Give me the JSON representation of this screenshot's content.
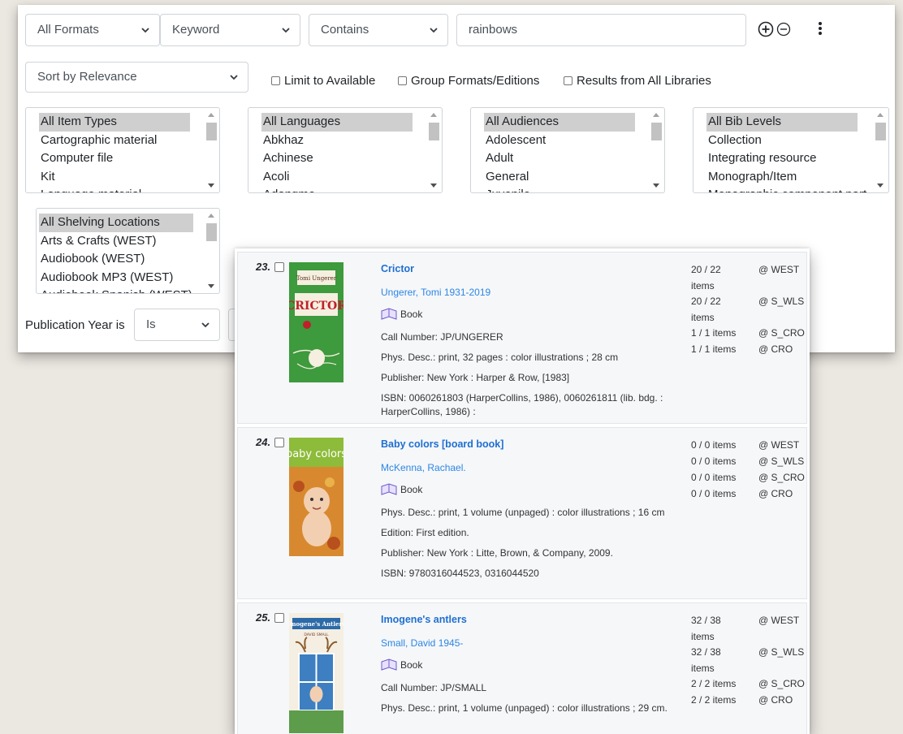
{
  "search": {
    "format": "All Formats",
    "field": "Keyword",
    "operator": "Contains",
    "query": "rainbows",
    "sort": "Sort by Relevance",
    "limit_available": "Limit to Available",
    "group_formats": "Group Formats/Editions",
    "all_libraries": "Results from All Libraries"
  },
  "filters": {
    "item_types": [
      "All Item Types",
      "Cartographic material",
      "Computer file",
      "Kit",
      "Language material"
    ],
    "languages": [
      "All Languages",
      "Abkhaz",
      "Achinese",
      "Acoli",
      "Adangme"
    ],
    "audiences": [
      "All Audiences",
      "Adolescent",
      "Adult",
      "General",
      "Juvenile"
    ],
    "bib_levels": [
      "All Bib Levels",
      "Collection",
      "Integrating resource",
      "Monograph/Item",
      "Monographic component part"
    ],
    "shelving_locations": [
      "All Shelving Locations",
      "Arts & Crafts (WEST)",
      "Audiobook (WEST)",
      "Audiobook MP3 (WEST)",
      "Audiobook Spanish (WEST)"
    ]
  },
  "publication": {
    "label": "Publication Year is",
    "operator": "Is"
  },
  "results": [
    {
      "number": "23.",
      "title": "Crictor",
      "author": "Ungerer, Tomi 1931-2019",
      "format": "Book",
      "cover_text": "CRICTOR",
      "cover_author": "Tomi Ungerer",
      "details": [
        "Call Number: JP/UNGERER",
        "Phys. Desc.: print, 32 pages : color illustrations ; 28 cm",
        "Publisher: New York : Harper & Row, [1983]",
        "ISBN: 0060261803 (HarperCollins, 1986), 0060261811 (lib. bdg. : HarperCollins, 1986) :"
      ],
      "holdings": [
        {
          "count": "20 / 22 items",
          "location": "@ WEST"
        },
        {
          "count": "20 / 22 items",
          "location": "@ S_WLS"
        },
        {
          "count": "1 / 1 items",
          "location": "@ S_CRO"
        },
        {
          "count": "1 / 1 items",
          "location": "@ CRO"
        }
      ]
    },
    {
      "number": "24.",
      "title": "Baby colors [board book]",
      "author": "McKenna, Rachael.",
      "format": "Book",
      "cover_text": "baby colors",
      "details": [
        "Phys. Desc.: print, 1 volume (unpaged) : color illustrations ; 16 cm",
        "Edition: First edition.",
        "Publisher: New York : Litte, Brown, & Company, 2009.",
        "ISBN: 9780316044523, 0316044520"
      ],
      "holdings": [
        {
          "count": "0 / 0 items",
          "location": "@ WEST"
        },
        {
          "count": "0 / 0 items",
          "location": "@ S_WLS"
        },
        {
          "count": "0 / 0 items",
          "location": "@ S_CRO"
        },
        {
          "count": "0 / 0 items",
          "location": "@ CRO"
        }
      ]
    },
    {
      "number": "25.",
      "title": "Imogene's antlers",
      "author": "Small, David 1945-",
      "format": "Book",
      "cover_text": "Imogene's Antlers",
      "cover_author": "DAVID SMALL",
      "details": [
        "Call Number: JP/SMALL",
        "Phys. Desc.: print, 1 volume (unpaged) : color illustrations ; 29 cm."
      ],
      "holdings": [
        {
          "count": "32 / 38 items",
          "location": "@ WEST"
        },
        {
          "count": "32 / 38 items",
          "location": "@ S_WLS"
        },
        {
          "count": "2 / 2 items",
          "location": "@ S_CRO"
        },
        {
          "count": "2 / 2 items",
          "location": "@ CRO"
        }
      ]
    }
  ]
}
